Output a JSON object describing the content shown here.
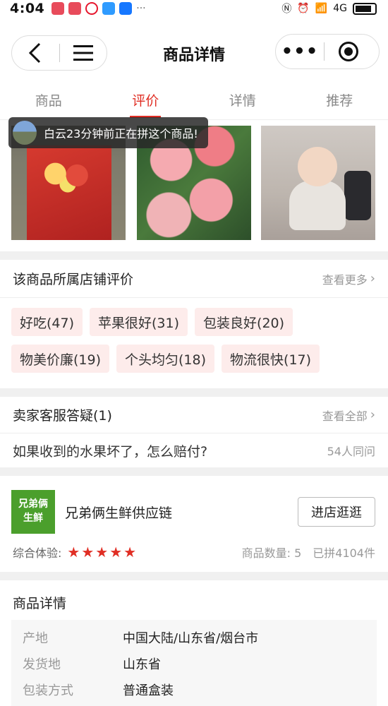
{
  "status_bar": {
    "time": "4:04",
    "notification_icons": [
      "app-icon",
      "app-icon",
      "weibo-icon",
      "message-icon",
      "alipay-icon"
    ],
    "more": "···",
    "network": "4G"
  },
  "navbar": {
    "title": "商品详情",
    "back_icon": "back-chevron-icon",
    "menu_icon": "hamburger-icon",
    "more_icon": "more-dots-icon",
    "close_icon": "target-icon"
  },
  "tabs": [
    {
      "label": "商品",
      "active": false
    },
    {
      "label": "评价",
      "active": true
    },
    {
      "label": "详情",
      "active": false
    },
    {
      "label": "推荐",
      "active": false
    }
  ],
  "toast": {
    "text": "白云23分钟前正在拼这个商品!"
  },
  "store_reviews": {
    "title": "该商品所属店铺评价",
    "more_label": "查看更多",
    "tags": [
      "好吃(47)",
      "苹果很好(31)",
      "包装良好(20)",
      "物美价廉(19)",
      "个头均匀(18)",
      "物流很快(17)"
    ]
  },
  "qa": {
    "title": "卖家客服答疑(1)",
    "more_label": "查看全部",
    "question": "如果收到的水果坏了，怎么赔付?",
    "agree_count": "54人同问"
  },
  "store": {
    "logo_text_line1": "兄弟俩",
    "logo_text_line2": "生鲜",
    "name": "兄弟俩生鲜供应链",
    "button_label": "进店逛逛",
    "experience_label": "综合体验:",
    "rating": 5,
    "product_count": "商品数量: 5",
    "sold_count": "已拼4104件"
  },
  "product_detail": {
    "title": "商品详情",
    "attributes": [
      {
        "key": "产地",
        "value": "中国大陆/山东省/烟台市"
      },
      {
        "key": "发货地",
        "value": "山东省"
      },
      {
        "key": "包装方式",
        "value": "普通盒装"
      }
    ]
  },
  "colors": {
    "accent": "#e02e24",
    "tag_bg": "#fdeceb",
    "store_logo": "#4b9f2c"
  }
}
